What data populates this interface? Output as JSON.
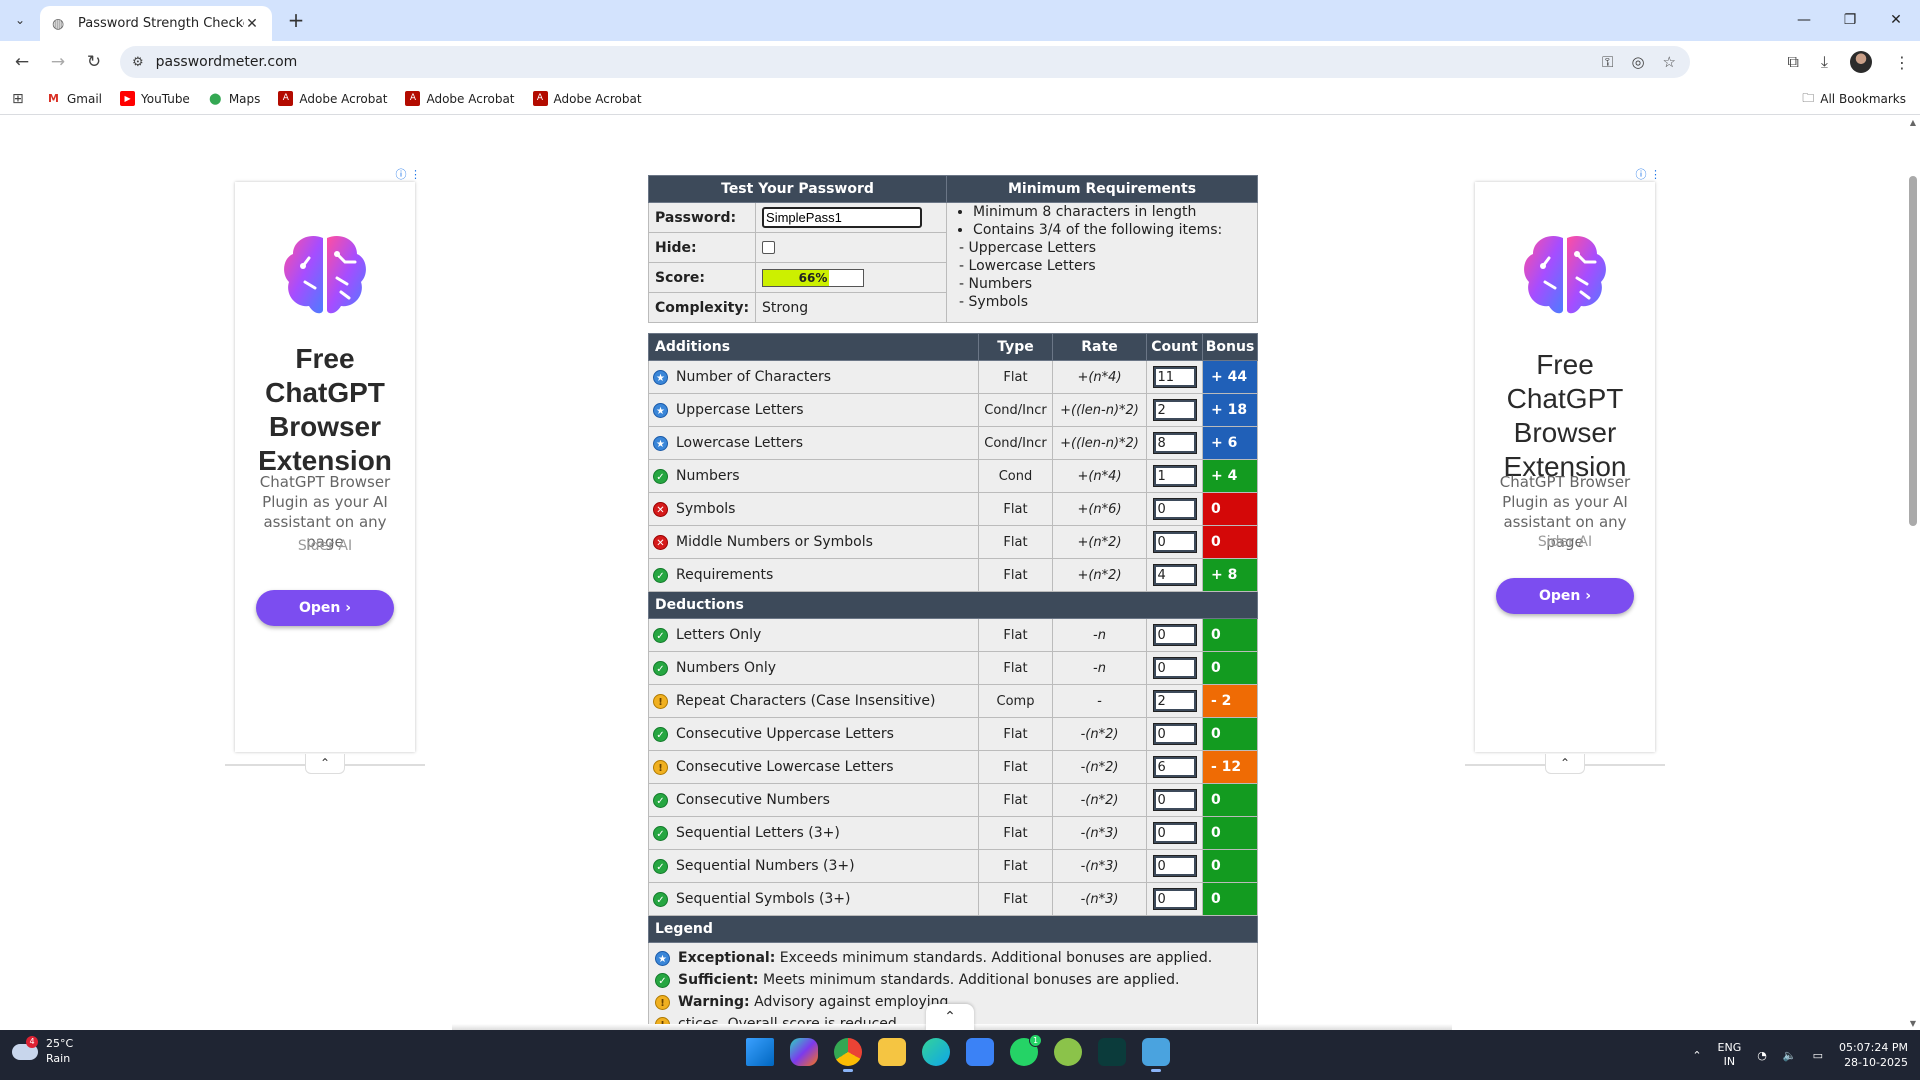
{
  "browser": {
    "tab_title": "Password Strength Checker",
    "url": "passwordmeter.com",
    "bookmarks": [
      {
        "label": "Gmail",
        "icon": "gmail-icon"
      },
      {
        "label": "YouTube",
        "icon": "youtube-icon"
      },
      {
        "label": "Maps",
        "icon": "maps-icon"
      },
      {
        "label": "Adobe Acrobat",
        "icon": "acrobat-icon"
      },
      {
        "label": "Adobe Acrobat",
        "icon": "acrobat-icon"
      },
      {
        "label": "Adobe Acrobat",
        "icon": "acrobat-icon"
      }
    ],
    "all_bookmarks": "All Bookmarks"
  },
  "ads": {
    "left": {
      "title": "Free ChatGPT Browser Extension",
      "desc": "ChatGPT Browser Plugin as your AI assistant on any page",
      "sponsor": "Sider AI",
      "button": "Open ›"
    },
    "right": {
      "title": "Free ChatGPT Browser Extension",
      "desc": "ChatGPT Browser Plugin as your AI assistant on any page",
      "sponsor": "Sider AI",
      "button": "Open ›"
    }
  },
  "test": {
    "header_left": "Test Your Password",
    "header_right": "Minimum Requirements",
    "password_label": "Password:",
    "password_value": "SimplePass1",
    "hide_label": "Hide:",
    "score_label": "Score:",
    "score_value": "66%",
    "score_fraction": 0.66,
    "complexity_label": "Complexity:",
    "complexity_value": "Strong",
    "requirements": [
      "Minimum 8 characters in length",
      "Contains 3/4 of the following items:"
    ],
    "requirement_items": [
      "- Uppercase Letters",
      "- Lowercase Letters",
      "- Numbers",
      "- Symbols"
    ]
  },
  "columns": {
    "additions": "Additions",
    "type": "Type",
    "rate": "Rate",
    "count": "Count",
    "bonus": "Bonus",
    "deductions": "Deductions",
    "legend": "Legend"
  },
  "additions": [
    {
      "status": "exceptional",
      "name": "Number of Characters",
      "type": "Flat",
      "rate": "+(n*4)",
      "count": "11",
      "bonus": "+ 44",
      "color": "blue"
    },
    {
      "status": "exceptional",
      "name": "Uppercase Letters",
      "type": "Cond/Incr",
      "rate": "+((len-n)*2)",
      "count": "2",
      "bonus": "+ 18",
      "color": "blue"
    },
    {
      "status": "exceptional",
      "name": "Lowercase Letters",
      "type": "Cond/Incr",
      "rate": "+((len-n)*2)",
      "count": "8",
      "bonus": "+ 6",
      "color": "blue"
    },
    {
      "status": "sufficient",
      "name": "Numbers",
      "type": "Cond",
      "rate": "+(n*4)",
      "count": "1",
      "bonus": "+ 4",
      "color": "green"
    },
    {
      "status": "failure",
      "name": "Symbols",
      "type": "Flat",
      "rate": "+(n*6)",
      "count": "0",
      "bonus": "0",
      "color": "red"
    },
    {
      "status": "failure",
      "name": "Middle Numbers or Symbols",
      "type": "Flat",
      "rate": "+(n*2)",
      "count": "0",
      "bonus": "0",
      "color": "red"
    },
    {
      "status": "sufficient",
      "name": "Requirements",
      "type": "Flat",
      "rate": "+(n*2)",
      "count": "4",
      "bonus": "+ 8",
      "color": "green"
    }
  ],
  "deductions": [
    {
      "status": "sufficient",
      "name": "Letters Only",
      "type": "Flat",
      "rate": "-n",
      "count": "0",
      "bonus": "0",
      "color": "green"
    },
    {
      "status": "sufficient",
      "name": "Numbers Only",
      "type": "Flat",
      "rate": "-n",
      "count": "0",
      "bonus": "0",
      "color": "green"
    },
    {
      "status": "warning",
      "name": "Repeat Characters (Case Insensitive)",
      "type": "Comp",
      "rate": "-",
      "count": "2",
      "bonus": "- 2",
      "color": "orange"
    },
    {
      "status": "sufficient",
      "name": "Consecutive Uppercase Letters",
      "type": "Flat",
      "rate": "-(n*2)",
      "count": "0",
      "bonus": "0",
      "color": "green"
    },
    {
      "status": "warning",
      "name": "Consecutive Lowercase Letters",
      "type": "Flat",
      "rate": "-(n*2)",
      "count": "6",
      "bonus": "- 12",
      "color": "orange"
    },
    {
      "status": "sufficient",
      "name": "Consecutive Numbers",
      "type": "Flat",
      "rate": "-(n*2)",
      "count": "0",
      "bonus": "0",
      "color": "green"
    },
    {
      "status": "sufficient",
      "name": "Sequential Letters (3+)",
      "type": "Flat",
      "rate": "-(n*3)",
      "count": "0",
      "bonus": "0",
      "color": "green"
    },
    {
      "status": "sufficient",
      "name": "Sequential Numbers (3+)",
      "type": "Flat",
      "rate": "-(n*3)",
      "count": "0",
      "bonus": "0",
      "color": "green"
    },
    {
      "status": "sufficient",
      "name": "Sequential Symbols (3+)",
      "type": "Flat",
      "rate": "-(n*3)",
      "count": "0",
      "bonus": "0",
      "color": "green"
    }
  ],
  "legend": [
    {
      "status": "exceptional",
      "term": "Exceptional:",
      "text": "Exceeds minimum standards. Additional bonuses are applied."
    },
    {
      "status": "sufficient",
      "term": "Sufficient:",
      "text": "Meets minimum standards. Additional bonuses are applied."
    },
    {
      "status": "warning",
      "term": "Warning:",
      "text": "Advisory against employing"
    },
    {
      "status": "warning",
      "term": "",
      "text": "ctices. Overall score is reduced."
    }
  ],
  "taskbar": {
    "temp": "25°C",
    "weather": "Rain",
    "weather_badge": "4",
    "lang": "ENG",
    "region": "IN",
    "time": "05:07:24 PM",
    "date": "28-10-2025",
    "whatsapp_badge": "1"
  },
  "colors": {
    "header": "#3d4a5a",
    "blue": "#2060b8",
    "green": "#139b20",
    "red": "#d40808",
    "orange": "#ef6b04",
    "score_bar": "#ccf000"
  }
}
